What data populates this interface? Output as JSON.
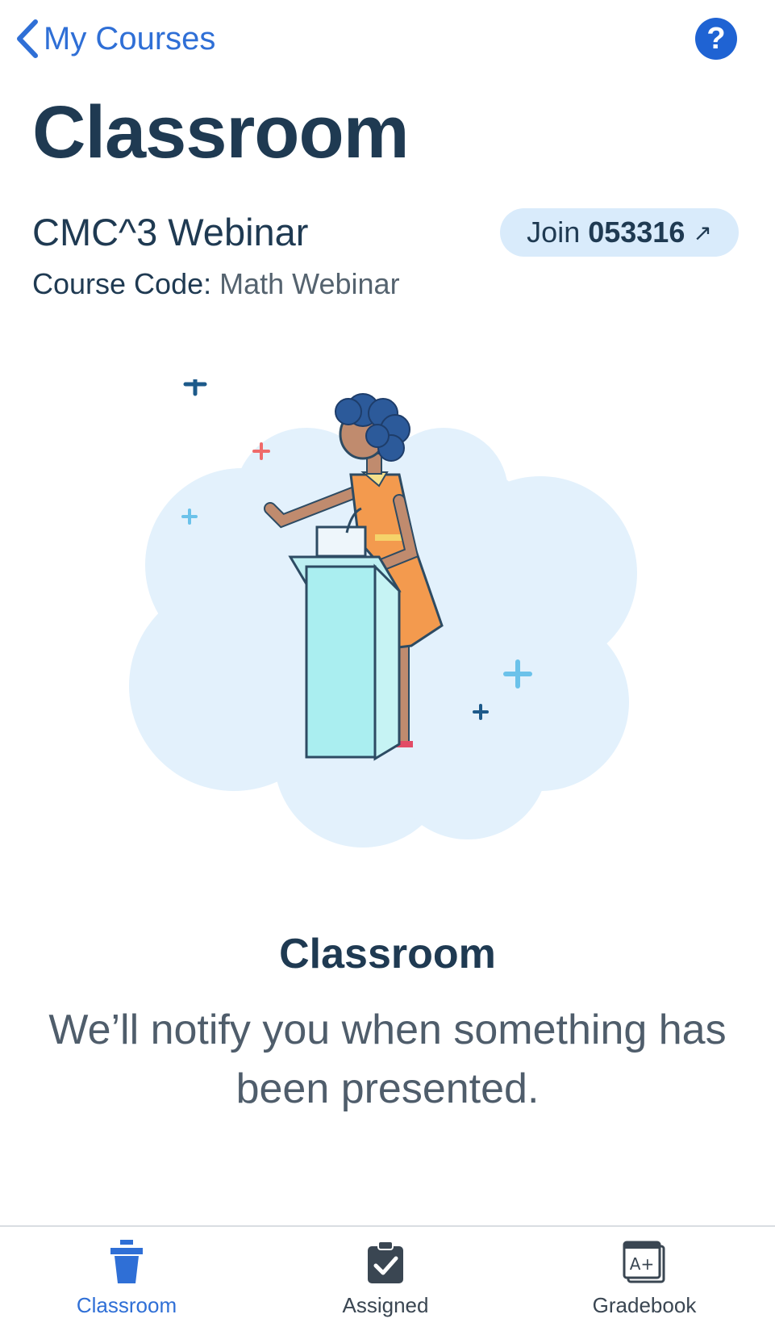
{
  "nav": {
    "back_label": "My Courses",
    "help_label": "?"
  },
  "page": {
    "title": "Classroom"
  },
  "course": {
    "name": "CMC^3 Webinar",
    "code_label": "Course Code:",
    "code_value": "Math Webinar"
  },
  "join": {
    "label": "Join",
    "code": "053316",
    "arrow": "↗"
  },
  "empty_state": {
    "title": "Classroom",
    "message": "We’ll notify you when something has been presented."
  },
  "tabs": [
    {
      "label": "Classroom",
      "icon": "podium-icon",
      "active": true
    },
    {
      "label": "Assigned",
      "icon": "clipboard-check-icon",
      "active": false
    },
    {
      "label": "Gradebook",
      "icon": "gradebook-icon",
      "active": false
    }
  ],
  "colors": {
    "accent": "#2f6fd6",
    "primary_text": "#1f3a52",
    "secondary_text": "#4f5d6b",
    "join_pill_bg": "#d9ebfb",
    "illustration_bg": "#e3f1fc"
  }
}
